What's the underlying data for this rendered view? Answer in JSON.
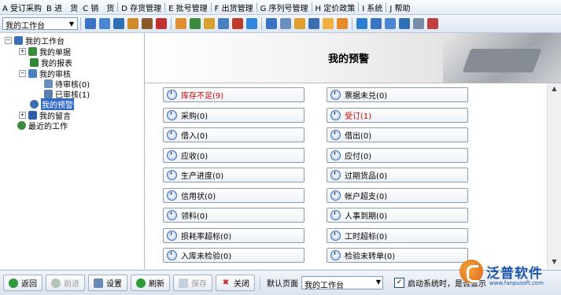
{
  "menu": [
    "A 受订采购",
    "B 进　货",
    "C 销　货",
    "D 存货管理",
    "E 批号管理",
    "F 出货管理",
    "G 序列号管理",
    "H 定价政策",
    "I 系统",
    "J 帮助"
  ],
  "toolbar": {
    "combo_value": "我的工作台",
    "icon_colors": [
      "#3a73c4",
      "#4a86d0",
      "#2f6fb5",
      "#d08b2c",
      "#8a5a2a",
      "#c03030",
      "#e09030",
      "#3c8a3c",
      "#d9a12a",
      "#4a7fc0",
      "#c0392b",
      "#2e86de",
      "#3a73c4",
      "#6a8fbf",
      "#e0a030",
      "#3c6db0",
      "#f0b040",
      "#e68a2e",
      "#2c7fd0",
      "#3a73c4",
      "#4a86d0",
      "#2f6fb5",
      "#7a8da8",
      "#c04040"
    ]
  },
  "tree": {
    "root": "我的工作台",
    "items": [
      {
        "label": "我的单据"
      },
      {
        "label": "我的报表"
      },
      {
        "label": "我的审核"
      },
      {
        "label": "待审核(0)"
      },
      {
        "label": "已审核(1)"
      },
      {
        "label": "我的预警"
      },
      {
        "label": "我的留言"
      },
      {
        "label": "最近的工作"
      }
    ]
  },
  "panel": {
    "title": "我的预警"
  },
  "warnings": [
    {
      "label": "库存不足(9)",
      "alert": true
    },
    {
      "label": "票据未兑(0)",
      "alert": false
    },
    {
      "label": "采购(0)",
      "alert": false
    },
    {
      "label": "受订(1)",
      "alert": true
    },
    {
      "label": "借入(0)",
      "alert": false
    },
    {
      "label": "借出(0)",
      "alert": false
    },
    {
      "label": "应收(0)",
      "alert": false
    },
    {
      "label": "应付(0)",
      "alert": false
    },
    {
      "label": "生产进度(0)",
      "alert": false
    },
    {
      "label": "过期货品(0)",
      "alert": false
    },
    {
      "label": "信用状(0)",
      "alert": false
    },
    {
      "label": "帐户超支(0)",
      "alert": false
    },
    {
      "label": "领料(0)",
      "alert": false
    },
    {
      "label": "人事到期(0)",
      "alert": false
    },
    {
      "label": "损耗率超标(0)",
      "alert": false
    },
    {
      "label": "工时超标(0)",
      "alert": false
    },
    {
      "label": "入库未检验(0)",
      "alert": false
    },
    {
      "label": "检验未转单(0)",
      "alert": false
    }
  ],
  "bottom": {
    "back": "返回",
    "forward": "前进",
    "settings": "设置",
    "refresh": "刷新",
    "save": "保存",
    "close": "关闭",
    "default_label": "默认页面",
    "default_value": "我的工作台",
    "startup_label": "启动系统时，是否显示",
    "startup_checked": "✓"
  },
  "brand": {
    "name": "泛普软件",
    "url": "www.fanpusoft.com"
  },
  "colors": {
    "alert": "#d60000",
    "selection": "#3169c6"
  }
}
